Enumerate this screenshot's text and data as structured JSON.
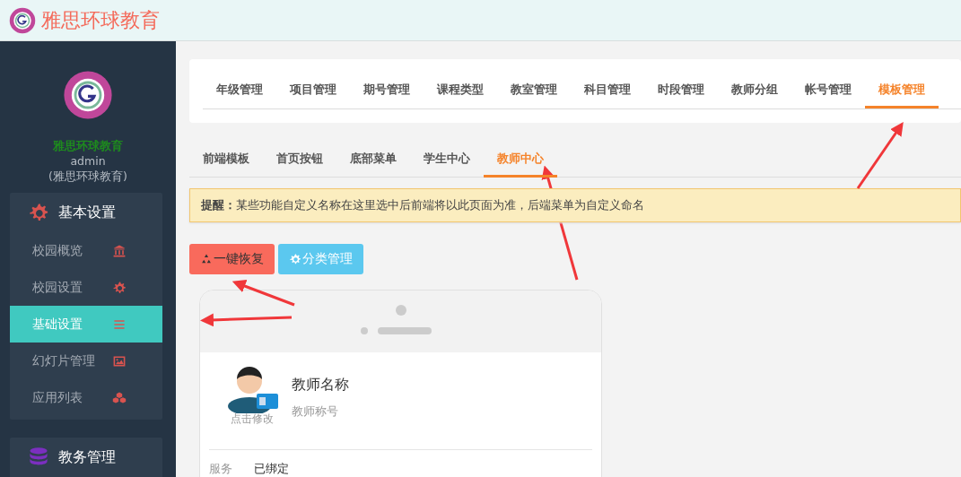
{
  "header": {
    "title": "雅思环球教育"
  },
  "sidebar": {
    "school": "雅思环球教育",
    "user": "admin",
    "org": "(雅思环球教育)",
    "groups": [
      {
        "title": "基本设置",
        "kind": "gear",
        "items": [
          {
            "label": "校园概览",
            "kind": "bank",
            "selected": false
          },
          {
            "label": "校园设置",
            "kind": "gear",
            "selected": false
          },
          {
            "label": "基础设置",
            "kind": "list",
            "selected": true
          },
          {
            "label": "幻灯片管理",
            "kind": "image",
            "selected": false
          },
          {
            "label": "应用列表",
            "kind": "cubes",
            "selected": false
          }
        ]
      },
      {
        "title": "教务管理",
        "kind": "database"
      }
    ]
  },
  "tabs": [
    {
      "label": "年级管理",
      "selected": false
    },
    {
      "label": "项目管理",
      "selected": false
    },
    {
      "label": "期号管理",
      "selected": false
    },
    {
      "label": "课程类型",
      "selected": false
    },
    {
      "label": "教室管理",
      "selected": false
    },
    {
      "label": "科目管理",
      "selected": false
    },
    {
      "label": "时段管理",
      "selected": false
    },
    {
      "label": "教师分组",
      "selected": false
    },
    {
      "label": "帐号管理",
      "selected": false
    },
    {
      "label": "模板管理",
      "selected": true
    }
  ],
  "subtabs": [
    {
      "label": "前端模板",
      "selected": false
    },
    {
      "label": "首页按钮",
      "selected": false
    },
    {
      "label": "底部菜单",
      "selected": false
    },
    {
      "label": "学生中心",
      "selected": false
    },
    {
      "label": "教师中心",
      "selected": true
    }
  ],
  "notice": "**提醒：**某些功能自定义名称在这里选中后前端将以此页面为准，后端菜单为自定义命名",
  "buttons": [
    {
      "label": "一键恢复",
      "kind": "restore"
    },
    {
      "label": "分类管理",
      "kind": "category"
    }
  ],
  "phone": {
    "avatar_caption": "点击修改",
    "name": "教师名称",
    "title": "教师称号",
    "rows": [
      {
        "label": "服务",
        "value": "已绑定"
      }
    ]
  }
}
